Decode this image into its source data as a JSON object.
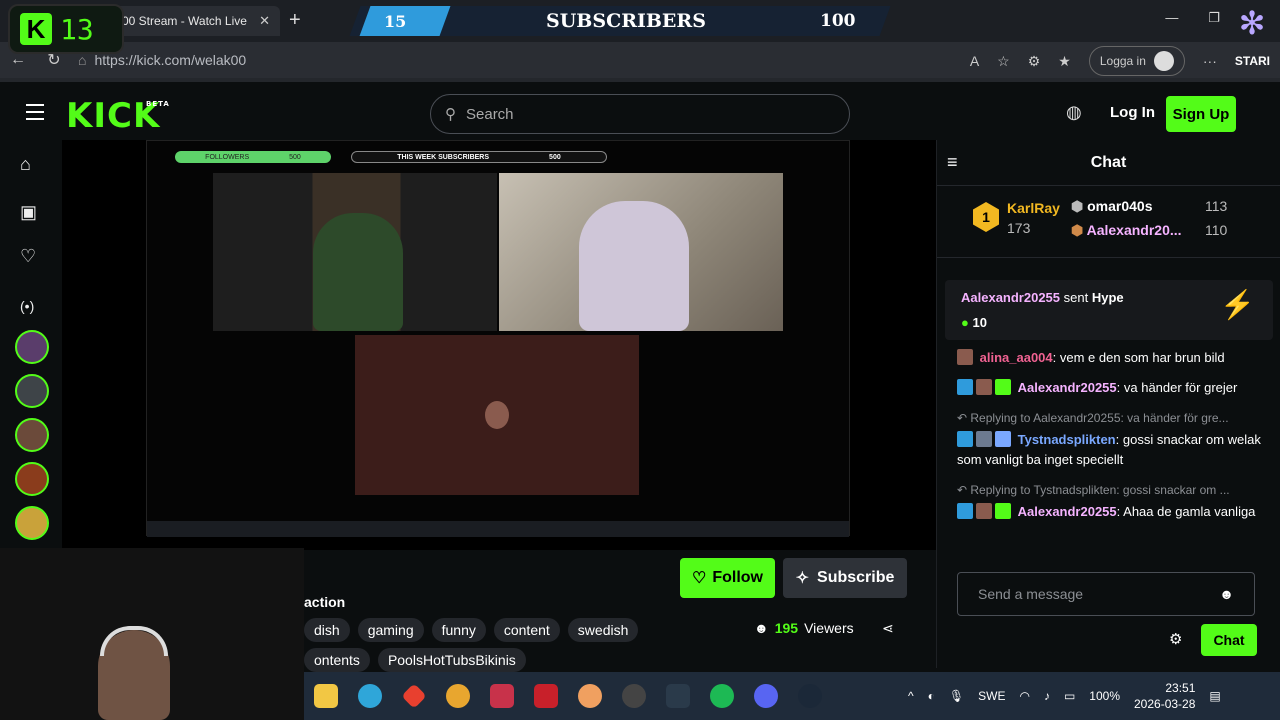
{
  "overlay": {
    "kick_count": "13",
    "sub_count": "15",
    "sub_label": "SUBSCRIBERS",
    "sub_goal": "100"
  },
  "browser": {
    "tab_title": "00 Stream - Watch Live",
    "url": "https://kick.com/welak00",
    "login_label": "Logga in",
    "brand": "STARI"
  },
  "header": {
    "logo": "KICK",
    "logo_tag": "BETA",
    "search_placeholder": "Search",
    "login_label": "Log In",
    "signup_label": "Sign Up"
  },
  "stream_overlay": {
    "followers_label": "FOLLOWERS",
    "followers_goal": "500",
    "week_subs_label": "THIS WEEK SUBSCRIBERS",
    "week_subs_goal": "500"
  },
  "stream": {
    "category_fragment": "action",
    "tags": [
      "dish",
      "gaming",
      "funny",
      "content",
      "swedish"
    ],
    "tags2": [
      "ontents",
      "PoolsHotTubsBikinis"
    ],
    "follow_label": "Follow",
    "subscribe_label": "Subscribe",
    "viewers_count": "195",
    "viewers_label": "Viewers"
  },
  "chat": {
    "title": "Chat",
    "leaderboard": {
      "first": {
        "rank": "1",
        "name": "KarlRay",
        "count": "173"
      },
      "second": {
        "name": "omar040s",
        "count": "113"
      },
      "third": {
        "name": "Aalexandr20...",
        "count": "110"
      }
    },
    "pinned": {
      "user": "Aalexandr20255",
      "verb": "sent",
      "item": "Hype",
      "amount": "10"
    },
    "messages": [
      {
        "user": "alina_aa004",
        "color": "#f06292",
        "text": "vem e den som har brun bild",
        "reply": ""
      },
      {
        "user": "Aalexandr20255",
        "color": "#f5b3ff",
        "text": "va händer för grejer",
        "reply": ""
      },
      {
        "user": "Tystnadsplikten",
        "color": "#7aa8ff",
        "text": "gossi snackar om welak som vanligt ba inget speciellt",
        "reply": "Replying to Aalexandr20255: va händer för gre..."
      },
      {
        "user": "Aalexandr20255",
        "color": "#f5b3ff",
        "text": "Ahaa de gamla vanliga",
        "reply": "Replying to Tystnadsplikten: gossi snackar om ..."
      }
    ],
    "input_placeholder": "Send a message",
    "send_label": "Chat"
  },
  "taskbar": {
    "lang": "SWE",
    "battery": "100%",
    "time": "23:51",
    "date": "2026-03-28"
  },
  "colors": {
    "accent": "#53fc18",
    "background": "#0b0e0f"
  }
}
